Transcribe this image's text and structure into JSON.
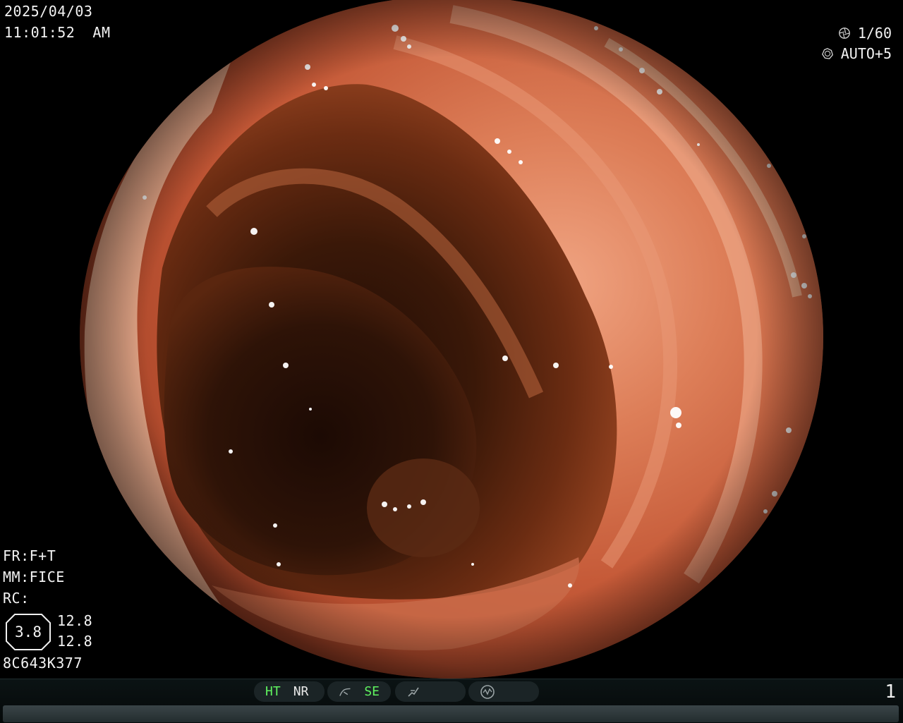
{
  "overlay": {
    "date": "2025/04/03",
    "time": "11:01:52  AM",
    "shutter": "1/60",
    "iris": "AUTO+5",
    "fr": "FR:F+T",
    "mm": "MM:FICE",
    "rc": "RC:",
    "zoom_value": "3.8",
    "value_1": "12.8",
    "value_2": "12.8",
    "serial": "8C643K377"
  },
  "statusbar": {
    "ht_label": "HT",
    "nr_label": "NR",
    "se_label": "SE",
    "page_number": "1"
  },
  "colors": {
    "active_indicator": "#5ff25f",
    "overlay_text": "#f3f3f3",
    "tissue": "#c0573a"
  },
  "icons": [
    "shutter-icon",
    "iris-icon",
    "tone-curve-icon",
    "enhance-icon",
    "waveform-icon"
  ]
}
